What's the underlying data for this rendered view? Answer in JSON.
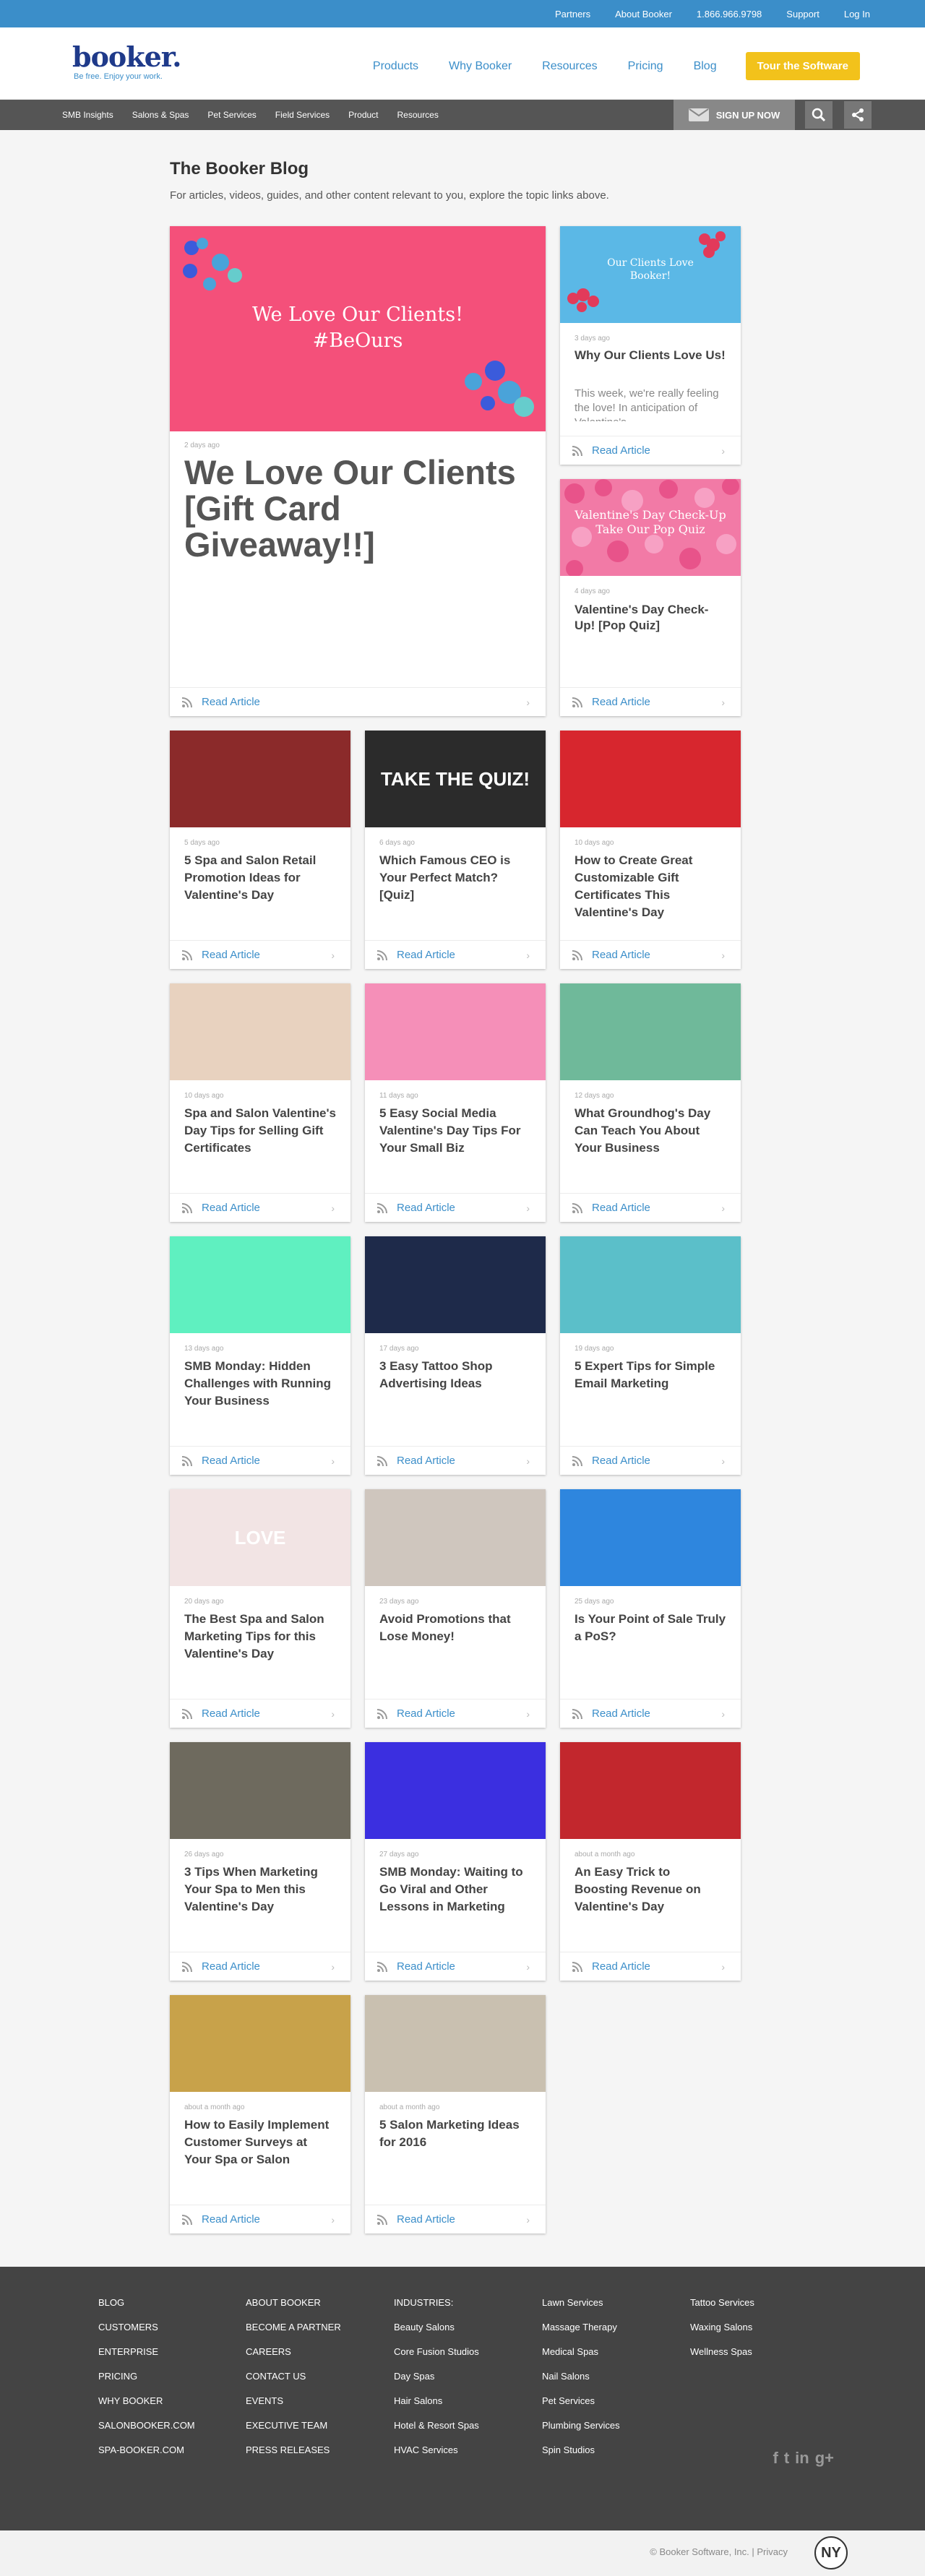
{
  "topbar": {
    "links": [
      "Partners",
      "About Booker",
      "1.866.966.9798",
      "Support",
      "Log In"
    ]
  },
  "logo": {
    "word": "booker.",
    "tagline": "Be free. Enjoy your work."
  },
  "mainnav": {
    "items": [
      "Products",
      "Why Booker",
      "Resources",
      "Pricing",
      "Blog"
    ],
    "cta": "Tour the Software"
  },
  "subnav": {
    "items": [
      "SMB Insights",
      "Salons & Spas",
      "Pet Services",
      "Field Services",
      "Product",
      "Resources"
    ],
    "signup": "SIGN UP NOW"
  },
  "intro": {
    "title": "The Booker Blog",
    "text": "For articles, videos, guides, and other content relevant to you, explore the topic links above."
  },
  "read_label": "Read Article",
  "featured": {
    "date": "2 days ago",
    "title": "We Love Our Clients [Gift Card Giveaway!!]",
    "image_text": "We Love Our Clients! #BeOurs"
  },
  "side": [
    {
      "date": "3 days ago",
      "title": "Why Our Clients Love Us!",
      "excerpt": "This week, we're really feeling the love! In anticipation of Valentine's",
      "image_text": "Our Clients Love Booker!"
    },
    {
      "date": "4 days ago",
      "title": "Valentine's Day Check-Up! [Pop Quiz]",
      "image_text": "Valentine's Day Check-Up Take Our Pop Quiz"
    }
  ],
  "posts": [
    {
      "date": "5 days ago",
      "title": "5 Spa and Salon Retail Promotion Ideas for Valentine's Day",
      "image_text": ""
    },
    {
      "date": "6 days ago",
      "title": "Which Famous CEO is Your Perfect Match? [Quiz]",
      "image_text": "TAKE THE QUIZ!"
    },
    {
      "date": "10 days ago",
      "title": "How to Create Great Customizable Gift Certificates This Valentine's Day",
      "image_text": ""
    },
    {
      "date": "10 days ago",
      "title": "Spa and Salon Valentine's Day Tips for Selling Gift Certificates",
      "image_text": ""
    },
    {
      "date": "11 days ago",
      "title": "5 Easy Social Media Valentine's Day Tips For Your Small Biz",
      "image_text": ""
    },
    {
      "date": "12 days ago",
      "title": "What Groundhog's Day Can Teach You About Your Business",
      "image_text": ""
    },
    {
      "date": "13 days ago",
      "title": "SMB Monday: Hidden Challenges with Running Your Business",
      "image_text": ""
    },
    {
      "date": "17 days ago",
      "title": "3 Easy Tattoo Shop Advertising Ideas",
      "image_text": ""
    },
    {
      "date": "19 days ago",
      "title": "5 Expert Tips for Simple Email Marketing",
      "image_text": ""
    },
    {
      "date": "20 days ago",
      "title": "The Best Spa and Salon Marketing Tips for this Valentine's Day",
      "image_text": "LOVE"
    },
    {
      "date": "23 days ago",
      "title": "Avoid Promotions that Lose Money!",
      "image_text": ""
    },
    {
      "date": "25 days ago",
      "title": "Is Your Point of Sale Truly a PoS?",
      "image_text": ""
    },
    {
      "date": "26 days ago",
      "title": "3 Tips When Marketing Your Spa to Men this Valentine's Day",
      "image_text": ""
    },
    {
      "date": "27 days ago",
      "title": "SMB Monday: Waiting to Go Viral and Other Lessons in Marketing",
      "image_text": ""
    },
    {
      "date": "about a month ago",
      "title": "An Easy Trick to Boosting Revenue on Valentine's Day",
      "image_text": ""
    },
    {
      "date": "about a month ago",
      "title": "How to Easily Implement Customer Surveys at Your Spa or Salon",
      "image_text": ""
    },
    {
      "date": "about a month ago",
      "title": "5 Salon Marketing Ideas for 2016",
      "image_text": ""
    }
  ],
  "footer": {
    "col1": [
      "BLOG",
      "CUSTOMERS",
      "ENTERPRISE",
      "PRICING",
      "WHY BOOKER",
      "SALONBOOKER.COM",
      "SPA-BOOKER.COM"
    ],
    "col2": [
      "ABOUT BOOKER",
      "BECOME A PARTNER",
      "CAREERS",
      "CONTACT US",
      "EVENTS",
      "EXECUTIVE TEAM",
      "PRESS RELEASES"
    ],
    "col3": [
      "INDUSTRIES:",
      "Beauty Salons",
      "Core Fusion Studios",
      "Day Spas",
      "Hair Salons",
      "Hotel & Resort Spas",
      "HVAC Services"
    ],
    "col4": [
      "Lawn Services",
      "Massage Therapy",
      "Medical Spas",
      "Nail Salons",
      "Pet Services",
      "Plumbing Services",
      "Spin Studios"
    ],
    "col5": [
      "Tattoo Services",
      "Waxing Salons",
      "Wellness Spas"
    ],
    "social": [
      "f",
      "t",
      "in",
      "g+"
    ],
    "copyright": "© Booker Software, Inc. | Privacy",
    "badge": "NY"
  },
  "colors": {
    "accent": "#3b8ec9",
    "cta": "#f2c21b",
    "footer": "#444444",
    "pink": "#f4507a"
  }
}
